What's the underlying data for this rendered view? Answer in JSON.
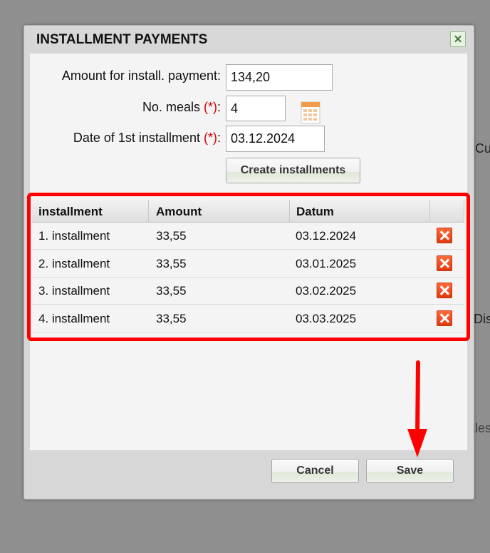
{
  "background": {
    "text_cu": "Cu",
    "text_dis": "Dis",
    "text_ales": "ales"
  },
  "dialog": {
    "title": "INSTALLMENT PAYMENTS",
    "close_icon": "close-icon",
    "form": {
      "amount_label": "Amount for install. payment:",
      "amount_value": "134,20",
      "meals_label": "No. meals",
      "meals_value": "4",
      "date_label": "Date of 1st installment",
      "date_value": "03.12.2024",
      "required_marker": "(*)",
      "colon": ":",
      "calendar_icon": "calendar-icon",
      "create_button": "Create installments"
    },
    "table": {
      "columns": [
        "installment",
        "Amount",
        "Datum",
        ""
      ],
      "rows": [
        {
          "installment": "1. installment",
          "amount": "33,55",
          "date": "03.12.2024"
        },
        {
          "installment": "2. installment",
          "amount": "33,55",
          "date": "03.01.2025"
        },
        {
          "installment": "3. installment",
          "amount": "33,55",
          "date": "03.02.2025"
        },
        {
          "installment": "4. installment",
          "amount": "33,55",
          "date": "03.03.2025"
        }
      ],
      "delete_icon": "delete-icon"
    },
    "footer": {
      "cancel": "Cancel",
      "save": "Save"
    }
  },
  "annotations": {
    "highlight_color": "#ff0000",
    "arrow_color": "#ff0000"
  }
}
